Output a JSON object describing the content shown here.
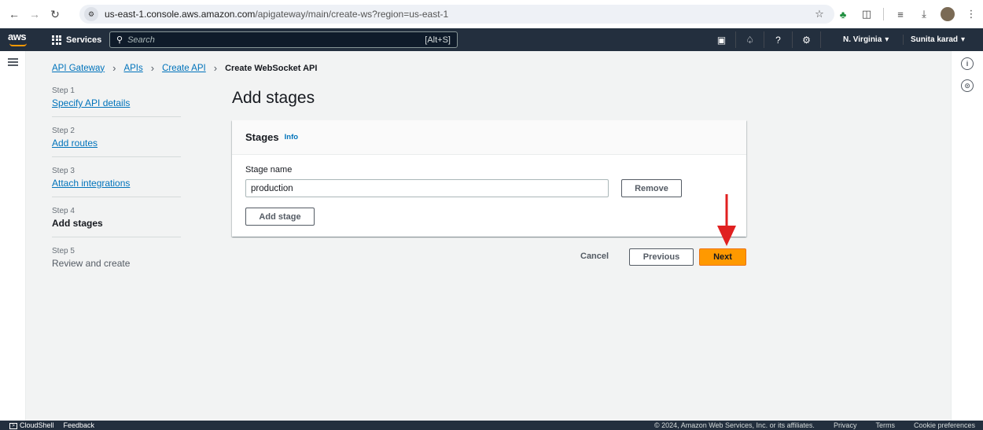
{
  "browser": {
    "url_host": "us-east-1.console.aws.amazon.com",
    "url_path": "/apigateway/main/create-ws?region=us-east-1"
  },
  "aws_nav": {
    "logo": "aws",
    "services": "Services",
    "search_placeholder": "Search",
    "search_shortcut": "[Alt+S]",
    "region": "N. Virginia",
    "user": "Sunita karad"
  },
  "breadcrumb": {
    "items": [
      "API Gateway",
      "APIs",
      "Create API"
    ],
    "current": "Create WebSocket API"
  },
  "steps": [
    {
      "num": "Step 1",
      "label": "Specify API details"
    },
    {
      "num": "Step 2",
      "label": "Add routes"
    },
    {
      "num": "Step 3",
      "label": "Attach integrations"
    },
    {
      "num": "Step 4",
      "label": "Add stages"
    },
    {
      "num": "Step 5",
      "label": "Review and create"
    }
  ],
  "main": {
    "title": "Add stages",
    "panel_title": "Stages",
    "panel_info": "Info",
    "field_label": "Stage name",
    "stage_value": "production",
    "remove_label": "Remove",
    "add_stage_label": "Add stage",
    "cancel_label": "Cancel",
    "previous_label": "Previous",
    "next_label": "Next"
  },
  "footer": {
    "cloudshell": "CloudShell",
    "feedback": "Feedback",
    "copyright": "© 2024, Amazon Web Services, Inc. or its affiliates.",
    "privacy": "Privacy",
    "terms": "Terms",
    "cookies": "Cookie preferences"
  },
  "colors": {
    "accent": "#ff9900",
    "link": "#0073bb",
    "nav_bg": "#232f3e",
    "arrow": "#e02020"
  }
}
